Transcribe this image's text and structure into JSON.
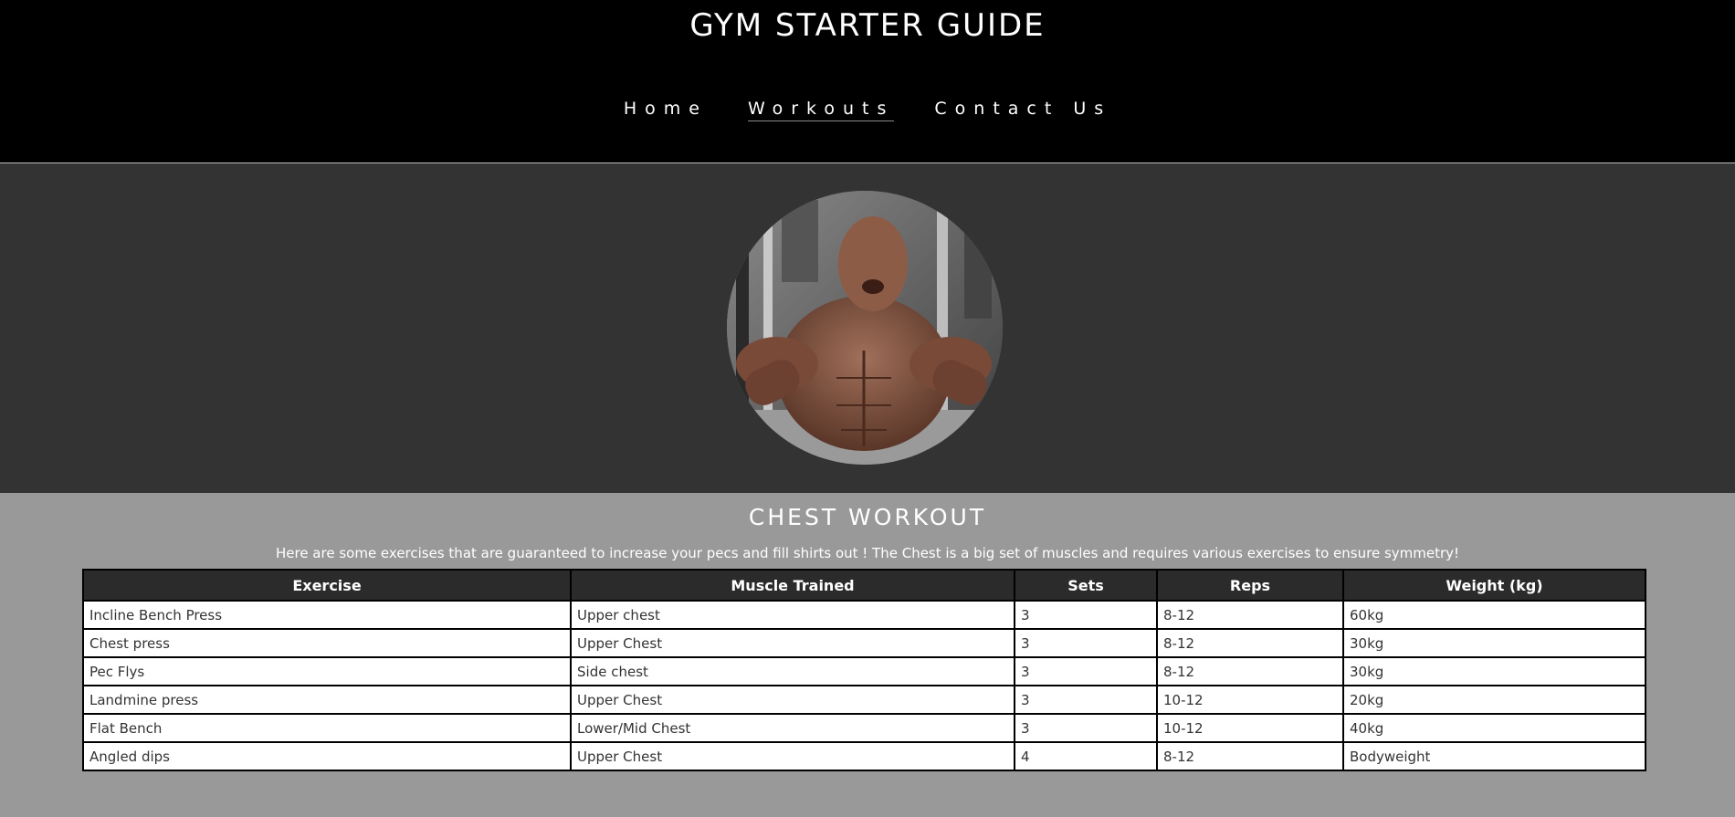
{
  "header": {
    "title": "GYM STARTER GUIDE",
    "nav": [
      "Home",
      "Workouts",
      "Contact Us"
    ],
    "active_nav": "Workouts"
  },
  "hero": {
    "image_alt": "Bodybuilder flexing in gym"
  },
  "section": {
    "title": "CHEST WORKOUT",
    "intro": "Here are some exercises that are guaranteed to increase your pecs and fill shirts out ! The Chest is a big set of muscles and requires various exercises to ensure symmetry!"
  },
  "table": {
    "headers": [
      "Exercise",
      "Muscle Trained",
      "Sets",
      "Reps",
      "Weight (kg)"
    ],
    "rows": [
      [
        "Incline Bench Press",
        "Upper chest",
        "3",
        "8-12",
        "60kg"
      ],
      [
        "Chest press",
        "Upper Chest",
        "3",
        "8-12",
        "30kg"
      ],
      [
        "Pec Flys",
        "Side chest",
        "3",
        "8-12",
        "30kg"
      ],
      [
        "Landmine press",
        "Upper Chest",
        "3",
        "10-12",
        "20kg"
      ],
      [
        "Flat Bench",
        "Lower/Mid Chest",
        "3",
        "10-12",
        "40kg"
      ],
      [
        "Angled dips",
        "Upper Chest",
        "4",
        "8-12",
        "Bodyweight"
      ]
    ]
  },
  "colors": {
    "header_bg": "#000000",
    "hero_bg": "#333333",
    "content_bg": "#999999",
    "table_header_bg": "#2b2b2b"
  }
}
